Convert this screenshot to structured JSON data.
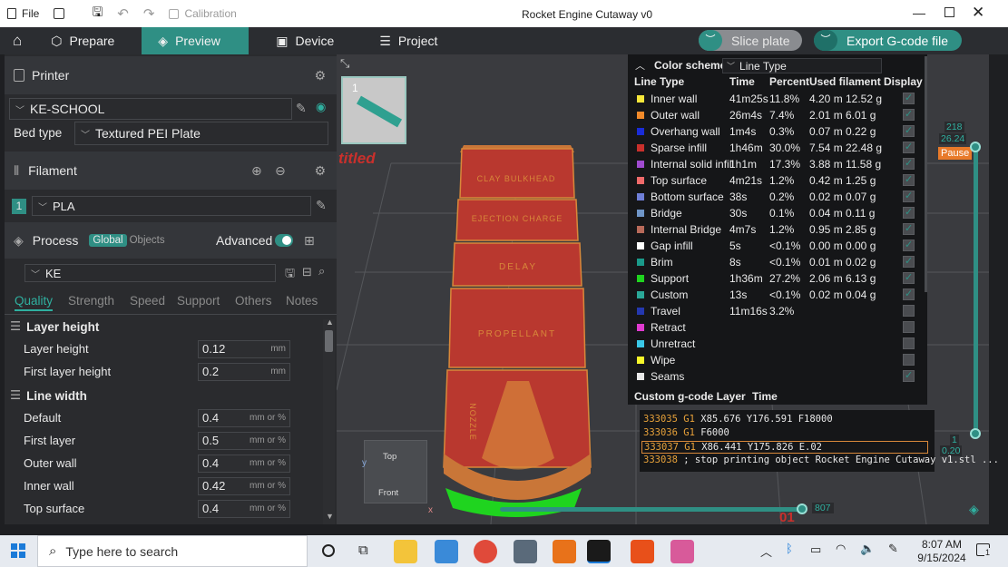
{
  "titlebar": {
    "file_label": "File",
    "calibration_label": "Calibration",
    "window_title": "Rocket Engine Cutaway v0"
  },
  "tabs": {
    "prepare": "Prepare",
    "preview": "Preview",
    "device": "Device",
    "project": "Project"
  },
  "actions": {
    "slice_plate": "Slice plate",
    "export_gcode": "Export G-code file"
  },
  "printer": {
    "header": "Printer",
    "name": "KE-SCHOOL",
    "bed_type_label": "Bed type",
    "bed_type_value": "Textured PEI Plate"
  },
  "filament": {
    "header": "Filament",
    "slot_number": "1",
    "value": "PLA"
  },
  "process": {
    "header": "Process",
    "global_label": "Global",
    "objects_label": "Objects",
    "advanced_label": "Advanced",
    "profile": "KE",
    "tabs": [
      "Quality",
      "Strength",
      "Speed",
      "Support",
      "Others",
      "Notes"
    ],
    "layer_height_group": "Layer height",
    "layer_height": {
      "label": "Layer height",
      "value": "0.12",
      "unit": "mm"
    },
    "first_layer_height": {
      "label": "First layer height",
      "value": "0.2",
      "unit": "mm"
    },
    "line_width_group": "Line width",
    "line_width_rows": [
      {
        "label": "Default",
        "value": "0.4",
        "unit": "mm or %"
      },
      {
        "label": "First layer",
        "value": "0.5",
        "unit": "mm or %"
      },
      {
        "label": "Outer wall",
        "value": "0.4",
        "unit": "mm or %"
      },
      {
        "label": "Inner wall",
        "value": "0.42",
        "unit": "mm or %"
      },
      {
        "label": "Top surface",
        "value": "0.4",
        "unit": "mm or %"
      }
    ]
  },
  "viewport": {
    "plate_number": "1",
    "plate_name_partial": "titled",
    "bands": [
      "CLAY BULKHEAD",
      "EJECTION CHARGE",
      "DELAY",
      "PROPELLANT",
      "NOZZLE"
    ],
    "cube_top": "Top",
    "cube_front": "Front",
    "axis_x": "x",
    "axis_y": "y",
    "vslider_top": "218",
    "vslider_top2": "26.24",
    "pause_label": "Pause",
    "vslider_bottom": "1",
    "vslider_bottom2": "0.20",
    "hslider_value": "807",
    "bottom_partial": "01"
  },
  "legend": {
    "color_scheme_label": "Color scheme",
    "color_scheme_value": "Line Type",
    "headers": [
      "Line Type",
      "Time",
      "Percent",
      "Used filament",
      "Display"
    ],
    "rows": [
      {
        "name": "Inner wall",
        "time": "41m25s",
        "pct": "11.8%",
        "len": "4.20 m",
        "weight": "12.52 g",
        "color": "#f7e73a",
        "display": true
      },
      {
        "name": "Outer wall",
        "time": "26m4s",
        "pct": "7.4%",
        "len": "2.01 m",
        "weight": "6.01 g",
        "color": "#f28a2a",
        "display": true
      },
      {
        "name": "Overhang wall",
        "time": "1m4s",
        "pct": "0.3%",
        "len": "0.07 m",
        "weight": "0.22 g",
        "color": "#1a2cd8",
        "display": true
      },
      {
        "name": "Sparse infill",
        "time": "1h46m",
        "pct": "30.0%",
        "len": "7.54 m",
        "weight": "22.48 g",
        "color": "#c9302c",
        "display": true
      },
      {
        "name": "Internal solid infill",
        "time": "1h1m",
        "pct": "17.3%",
        "len": "3.88 m",
        "weight": "11.58 g",
        "color": "#a04bd0",
        "display": true
      },
      {
        "name": "Top surface",
        "time": "4m21s",
        "pct": "1.2%",
        "len": "0.42 m",
        "weight": "1.25 g",
        "color": "#f06a6a",
        "display": true
      },
      {
        "name": "Bottom surface",
        "time": "38s",
        "pct": "0.2%",
        "len": "0.02 m",
        "weight": "0.07 g",
        "color": "#6f7fd8",
        "display": true
      },
      {
        "name": "Bridge",
        "time": "30s",
        "pct": "0.1%",
        "len": "0.04 m",
        "weight": "0.11 g",
        "color": "#6f96c8",
        "display": true
      },
      {
        "name": "Internal Bridge",
        "time": "4m7s",
        "pct": "1.2%",
        "len": "0.95 m",
        "weight": "2.85 g",
        "color": "#b86a5a",
        "display": true
      },
      {
        "name": "Gap infill",
        "time": "5s",
        "pct": "<0.1%",
        "len": "0.00 m",
        "weight": "0.00 g",
        "color": "#ffffff",
        "display": true
      },
      {
        "name": "Brim",
        "time": "8s",
        "pct": "<0.1%",
        "len": "0.01 m",
        "weight": "0.02 g",
        "color": "#1a9a8a",
        "display": true
      },
      {
        "name": "Support",
        "time": "1h36m",
        "pct": "27.2%",
        "len": "2.06 m",
        "weight": "6.13 g",
        "color": "#1fd41f",
        "display": true
      },
      {
        "name": "Custom",
        "time": "13s",
        "pct": "<0.1%",
        "len": "0.02 m",
        "weight": "0.04 g",
        "color": "#2aa898",
        "display": true
      },
      {
        "name": "Travel",
        "time": "11m16s",
        "pct": "3.2%",
        "len": "",
        "weight": "",
        "color": "#2438b0",
        "display": false
      },
      {
        "name": "Retract",
        "time": "",
        "pct": "",
        "len": "",
        "weight": "",
        "color": "#e03ad0",
        "display": false
      },
      {
        "name": "Unretract",
        "time": "",
        "pct": "",
        "len": "",
        "weight": "",
        "color": "#3ac8e8",
        "display": false
      },
      {
        "name": "Wipe",
        "time": "",
        "pct": "",
        "len": "",
        "weight": "",
        "color": "#f7f72a",
        "display": false
      },
      {
        "name": "Seams",
        "time": "",
        "pct": "",
        "len": "",
        "weight": "",
        "color": "#e8e8e8",
        "display": true
      }
    ],
    "custom_gcode_label": "Custom g-code Layer",
    "custom_gcode_time": "Time"
  },
  "gcode": [
    {
      "num": "333035",
      "cmd": "G1",
      "args": "X85.676 Y176.591 F18000"
    },
    {
      "num": "333036",
      "cmd": "G1",
      "args": "F6000"
    },
    {
      "num": "333037",
      "cmd": "G1",
      "args": "X86.441 Y175.826 E.02"
    },
    {
      "num": "333038",
      "cmd": "",
      "args": "; stop printing object Rocket Engine Cutaway v1.stl ..."
    }
  ],
  "taskbar": {
    "search_placeholder": "Type here to search",
    "time": "8:07 AM",
    "date": "9/15/2024",
    "notification_count": "1"
  }
}
